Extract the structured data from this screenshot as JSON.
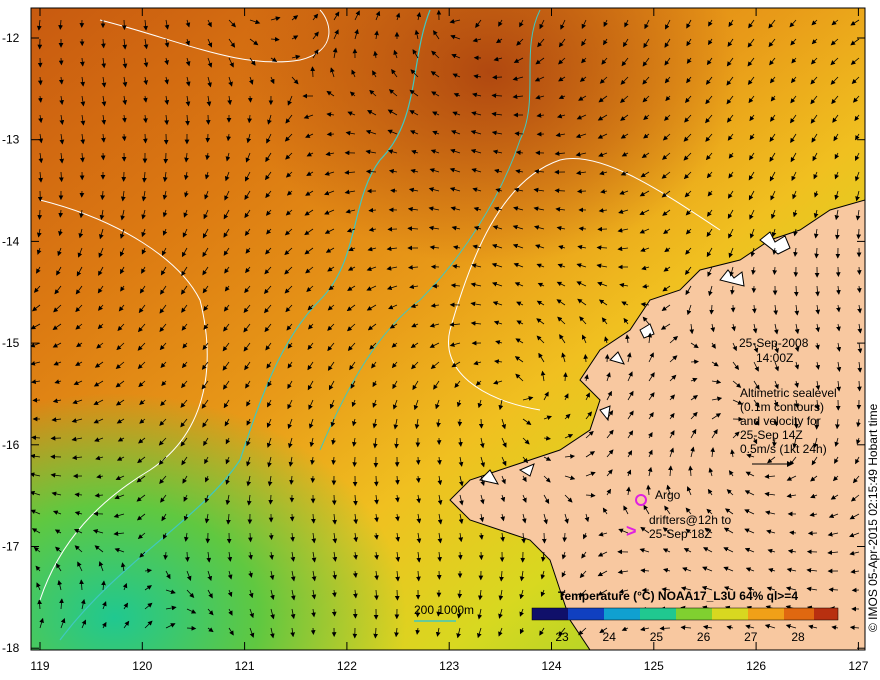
{
  "map": {
    "lat_ticks": [
      "-12",
      "-13",
      "-14",
      "-15",
      "-16",
      "-17",
      "-18"
    ],
    "lon_ticks": [
      "119",
      "120",
      "121",
      "122",
      "123",
      "124",
      "125",
      "126",
      "127"
    ],
    "date_line": "25-Sep-2008",
    "time_line": "14:00Z",
    "altimetry_lines": [
      "Altimetric sealevel",
      "(0.1m contours)",
      "and velocity for",
      "25-Sep 14Z",
      "0.5m/s (1kt 24h)"
    ],
    "argo_label": "Argo",
    "drifters_line1": "drifters@12h to",
    "drifters_line2": "25-Sep 18Z",
    "drifter_symbol": ">",
    "isobath_label": "200  1000m",
    "colorbar_title": "Temperature (°C) NOAA17_L3U 64% ql>=4",
    "colorbar_ticks": [
      "23",
      "24",
      "25",
      "26",
      "27",
      "28"
    ],
    "credit": "© IMOS 05-Apr-2015 02:15:49 Hobart time",
    "colors": {
      "land": "#f8c8a0",
      "isobath": "#40c8c0",
      "contour": "#ffffff",
      "marker": "#e020e0"
    }
  }
}
